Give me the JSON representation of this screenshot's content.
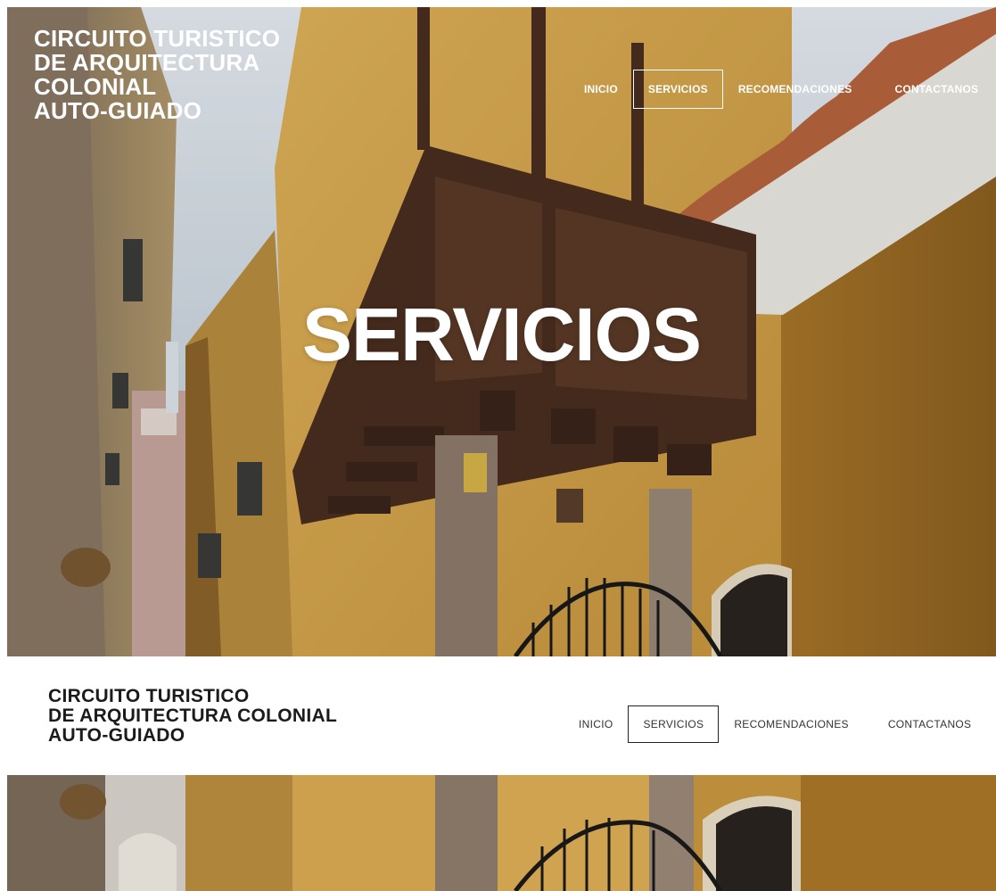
{
  "hero": {
    "brand": {
      "line1": "CIRCUITO TURISTICO",
      "line2": "DE ARQUITECTURA",
      "line3": "COLONIAL",
      "line4": "AUTO-GUIADO"
    },
    "heading": "SERVICIOS",
    "background_image": "colonial-street-balcony-photo"
  },
  "nav": {
    "items": [
      {
        "label": "INICIO"
      },
      {
        "label": "SERVICIOS",
        "active": true
      },
      {
        "label": "RECOMENDACIONES"
      },
      {
        "label": "CONTACTANOS"
      }
    ]
  },
  "sticky_header": {
    "brand": {
      "line1": "CIRCUITO TURISTICO",
      "line2": "DE ARQUITECTURA COLONIAL",
      "line3": "AUTO-GUIADO"
    }
  },
  "colors": {
    "wall_ochre": "#d6a648",
    "wall_dark_ochre": "#a8772a",
    "wood_dark": "#4a2e1f",
    "sky": "#c9d3de",
    "header_bg": "#ffffff",
    "header_text": "#1b1b1b",
    "roof_tile": "#b7643c"
  }
}
